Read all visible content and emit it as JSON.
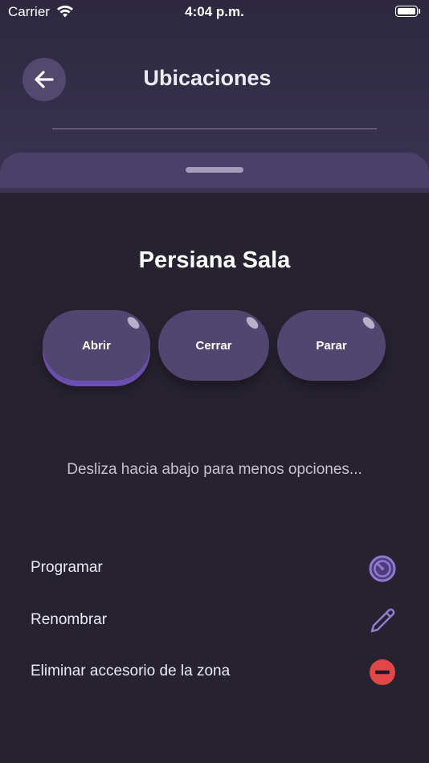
{
  "status_bar": {
    "carrier": "Carrier",
    "time": "4:04 p.m."
  },
  "header": {
    "title": "Ubicaciones"
  },
  "device": {
    "name": "Persiana Sala"
  },
  "controls": [
    {
      "label": "Abrir",
      "active": true
    },
    {
      "label": "Cerrar",
      "active": false
    },
    {
      "label": "Parar",
      "active": false
    }
  ],
  "hint": "Desliza hacia abajo para menos opciones...",
  "options": [
    {
      "label": "Programar",
      "icon": "timer-icon"
    },
    {
      "label": "Renombrar",
      "icon": "pencil-icon"
    },
    {
      "label": "Eliminar accesorio de la zona",
      "icon": "remove-icon"
    }
  ],
  "colors": {
    "accent": "#8f7ad1",
    "danger": "#e04848",
    "button": "#51466f",
    "background": "#262230"
  }
}
